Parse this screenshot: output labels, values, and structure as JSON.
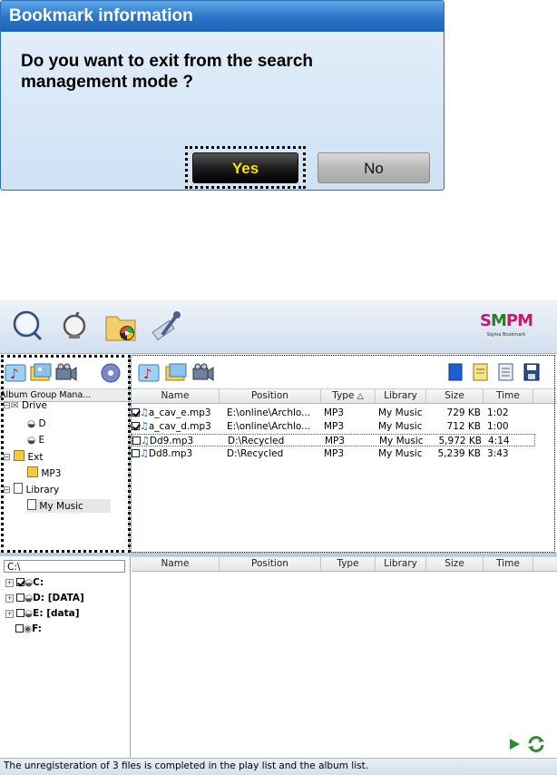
{
  "dialog": {
    "title": "Bookmark information",
    "message_line1": "Do you want to exit from the search",
    "message_line2": "management mode ?",
    "yes_label": "Yes",
    "no_label": "No"
  },
  "app": {
    "logo": {
      "mark_a": "S",
      "mark_b": "M",
      "mark_c": "PM",
      "sub": "Sigma Bookmark"
    },
    "toolbar_icons": [
      "search-icon",
      "magnifier-outline-icon",
      "folder-media-icon",
      "tools-icon"
    ],
    "left_panel": {
      "tab_icons": [
        "music-tab-icon",
        "picture-tab-icon",
        "video-tab-icon",
        "disc-tab-icon"
      ],
      "column_header": "Album Group Mana...",
      "tree": [
        {
          "label": "Drive",
          "level": 0
        },
        {
          "label": "D",
          "level": 1
        },
        {
          "label": "E",
          "level": 1
        },
        {
          "label": "Ext",
          "level": 0
        },
        {
          "label": "MP3",
          "level": 1
        },
        {
          "label": "Library",
          "level": 0
        },
        {
          "label": "My Music",
          "level": 1
        }
      ]
    },
    "file_list": {
      "tab_icons": [
        "music-tab-icon",
        "picture-tab-icon",
        "video-tab-icon"
      ],
      "right_icons": [
        "book-icon",
        "notepad-icon",
        "list-icon",
        "save-icon"
      ],
      "columns": [
        "Name",
        "Position",
        "Type",
        "Library",
        "Size",
        "Time"
      ],
      "sort_indicator": "△",
      "rows": [
        {
          "checked": true,
          "name": "a_cav_e.mp3",
          "position": "E:\\online\\Archlo...",
          "type": "MP3",
          "library": "My Music",
          "size": "729 KB",
          "time": "1:02"
        },
        {
          "checked": true,
          "name": "a_cav_d.mp3",
          "position": "E:\\online\\Archlo...",
          "type": "MP3",
          "library": "My Music",
          "size": "712 KB",
          "time": "1:00"
        },
        {
          "checked": false,
          "name": "Dd9.mp3",
          "position": "D:\\Recycled",
          "type": "MP3",
          "library": "My Music",
          "size": "5,972 KB",
          "time": "4:14"
        },
        {
          "checked": false,
          "name": "Dd8.mp3",
          "position": "D:\\Recycled",
          "type": "MP3",
          "library": "My Music",
          "size": "5,239 KB",
          "time": "3:43"
        }
      ]
    },
    "drive_panel": {
      "path": "C:\\",
      "drives": [
        {
          "checked": true,
          "label": "C:"
        },
        {
          "checked": false,
          "label": "D: [DATA]"
        },
        {
          "checked": false,
          "label": "E: [data]"
        },
        {
          "checked": false,
          "label": "F:"
        }
      ]
    },
    "lower_list": {
      "columns": [
        "Name",
        "Position",
        "Type",
        "Library",
        "Size",
        "Time"
      ]
    },
    "status": "The unregisteration of 3 files is completed in the play list and the album list."
  }
}
